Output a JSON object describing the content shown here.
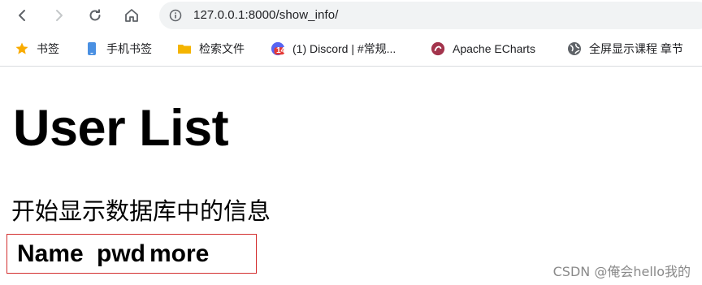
{
  "browser": {
    "url": "127.0.0.1:8000/show_info/",
    "bookmarks": [
      {
        "label": "书签",
        "icon": "star-icon"
      },
      {
        "label": "手机书签",
        "icon": "phone-icon"
      },
      {
        "label": "检索文件",
        "icon": "folder-icon"
      },
      {
        "label": "(1) Discord | #常规...",
        "icon": "discord-icon",
        "badge": "14"
      },
      {
        "label": "Apache ECharts",
        "icon": "echarts-icon"
      },
      {
        "label": "全屏显示课程 章节",
        "icon": "globe-icon"
      }
    ]
  },
  "page": {
    "heading": "User List",
    "intro": "开始显示数据库中的信息",
    "columns": [
      "Name",
      "pwd",
      "more"
    ]
  },
  "watermark": "CSDN @俺会hello我的",
  "colors": {
    "accent_star": "#f9ab00",
    "folder": "#f4b400",
    "border_red": "#d32f2f"
  }
}
